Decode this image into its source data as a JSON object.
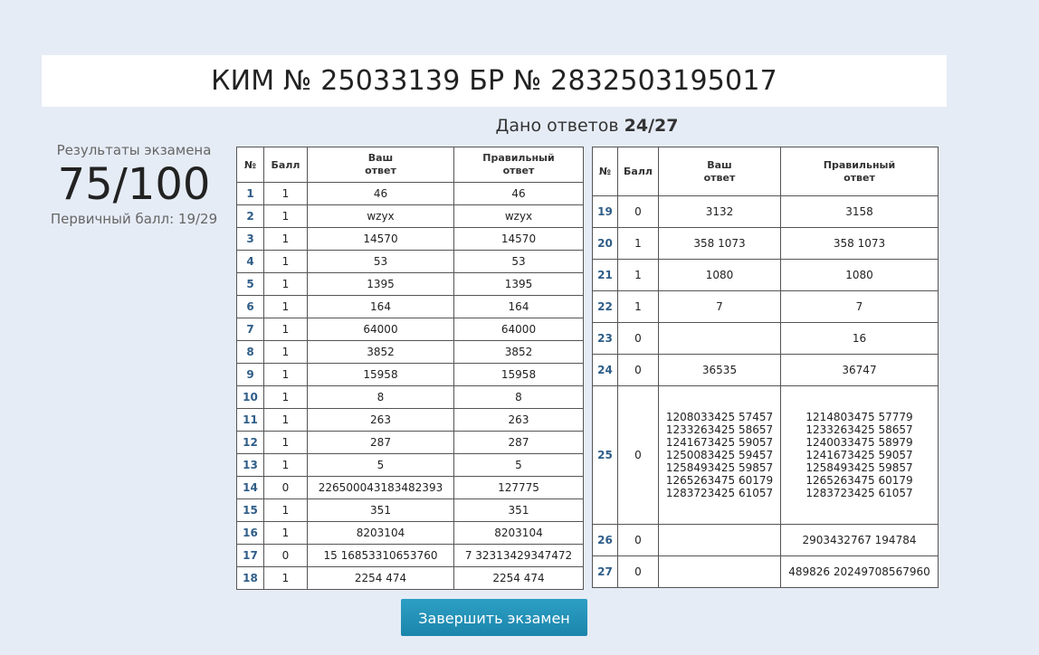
{
  "header": {
    "title": "КИМ № 25033139 БР № 2832503195017"
  },
  "answers": {
    "label": "Дано ответов",
    "count": "24/27"
  },
  "results": {
    "label": "Результаты экзамена",
    "score": "75/100",
    "primary": "Первичный балл: 19/29"
  },
  "table_headers": {
    "num": "№",
    "score": "Балл",
    "your_answer": "Ваш\nответ",
    "correct_answer": "Правильный\nответ"
  },
  "rows_left": [
    {
      "n": "1",
      "score": "1",
      "yours": "46",
      "correct": "46"
    },
    {
      "n": "2",
      "score": "1",
      "yours": "wzyx",
      "correct": "wzyx"
    },
    {
      "n": "3",
      "score": "1",
      "yours": "14570",
      "correct": "14570"
    },
    {
      "n": "4",
      "score": "1",
      "yours": "53",
      "correct": "53"
    },
    {
      "n": "5",
      "score": "1",
      "yours": "1395",
      "correct": "1395"
    },
    {
      "n": "6",
      "score": "1",
      "yours": "164",
      "correct": "164"
    },
    {
      "n": "7",
      "score": "1",
      "yours": "64000",
      "correct": "64000"
    },
    {
      "n": "8",
      "score": "1",
      "yours": "3852",
      "correct": "3852"
    },
    {
      "n": "9",
      "score": "1",
      "yours": "15958",
      "correct": "15958"
    },
    {
      "n": "10",
      "score": "1",
      "yours": "8",
      "correct": "8"
    },
    {
      "n": "11",
      "score": "1",
      "yours": "263",
      "correct": "263"
    },
    {
      "n": "12",
      "score": "1",
      "yours": "287",
      "correct": "287"
    },
    {
      "n": "13",
      "score": "1",
      "yours": "5",
      "correct": "5"
    },
    {
      "n": "14",
      "score": "0",
      "yours": "226500043183482393",
      "correct": "127775"
    },
    {
      "n": "15",
      "score": "1",
      "yours": "351",
      "correct": "351"
    },
    {
      "n": "16",
      "score": "1",
      "yours": "8203104",
      "correct": "8203104"
    },
    {
      "n": "17",
      "score": "0",
      "yours": "15 16853310653760",
      "correct": "7 32313429347472"
    },
    {
      "n": "18",
      "score": "1",
      "yours": "2254 474",
      "correct": "2254 474"
    }
  ],
  "rows_right": [
    {
      "n": "19",
      "score": "0",
      "yours": "3132",
      "correct": "3158"
    },
    {
      "n": "20",
      "score": "1",
      "yours": "358 1073",
      "correct": "358 1073"
    },
    {
      "n": "21",
      "score": "1",
      "yours": "1080",
      "correct": "1080"
    },
    {
      "n": "22",
      "score": "1",
      "yours": "7",
      "correct": "7"
    },
    {
      "n": "23",
      "score": "0",
      "yours": "",
      "correct": "16"
    },
    {
      "n": "24",
      "score": "0",
      "yours": "36535",
      "correct": "36747"
    },
    {
      "n": "25",
      "score": "0",
      "yours": "1208033425 57457\n1233263425 58657\n1241673425 59057\n1250083425 59457\n1258493425 59857\n1265263475 60179\n1283723425 61057",
      "correct": "1214803475 57779\n1233263425 58657\n1240033475 58979\n1241673425 59057\n1258493425 59857\n1265263475 60179\n1283723425 61057"
    },
    {
      "n": "26",
      "score": "0",
      "yours": "",
      "correct": "2903432767 194784"
    },
    {
      "n": "27",
      "score": "0",
      "yours": "",
      "correct": "489826 20249708567960"
    }
  ],
  "finish_button": {
    "label": "Завершить экзамен"
  },
  "colors": {
    "background": "#e6ecf6",
    "accent": "#1b85ab",
    "number": "#2f5d88"
  }
}
